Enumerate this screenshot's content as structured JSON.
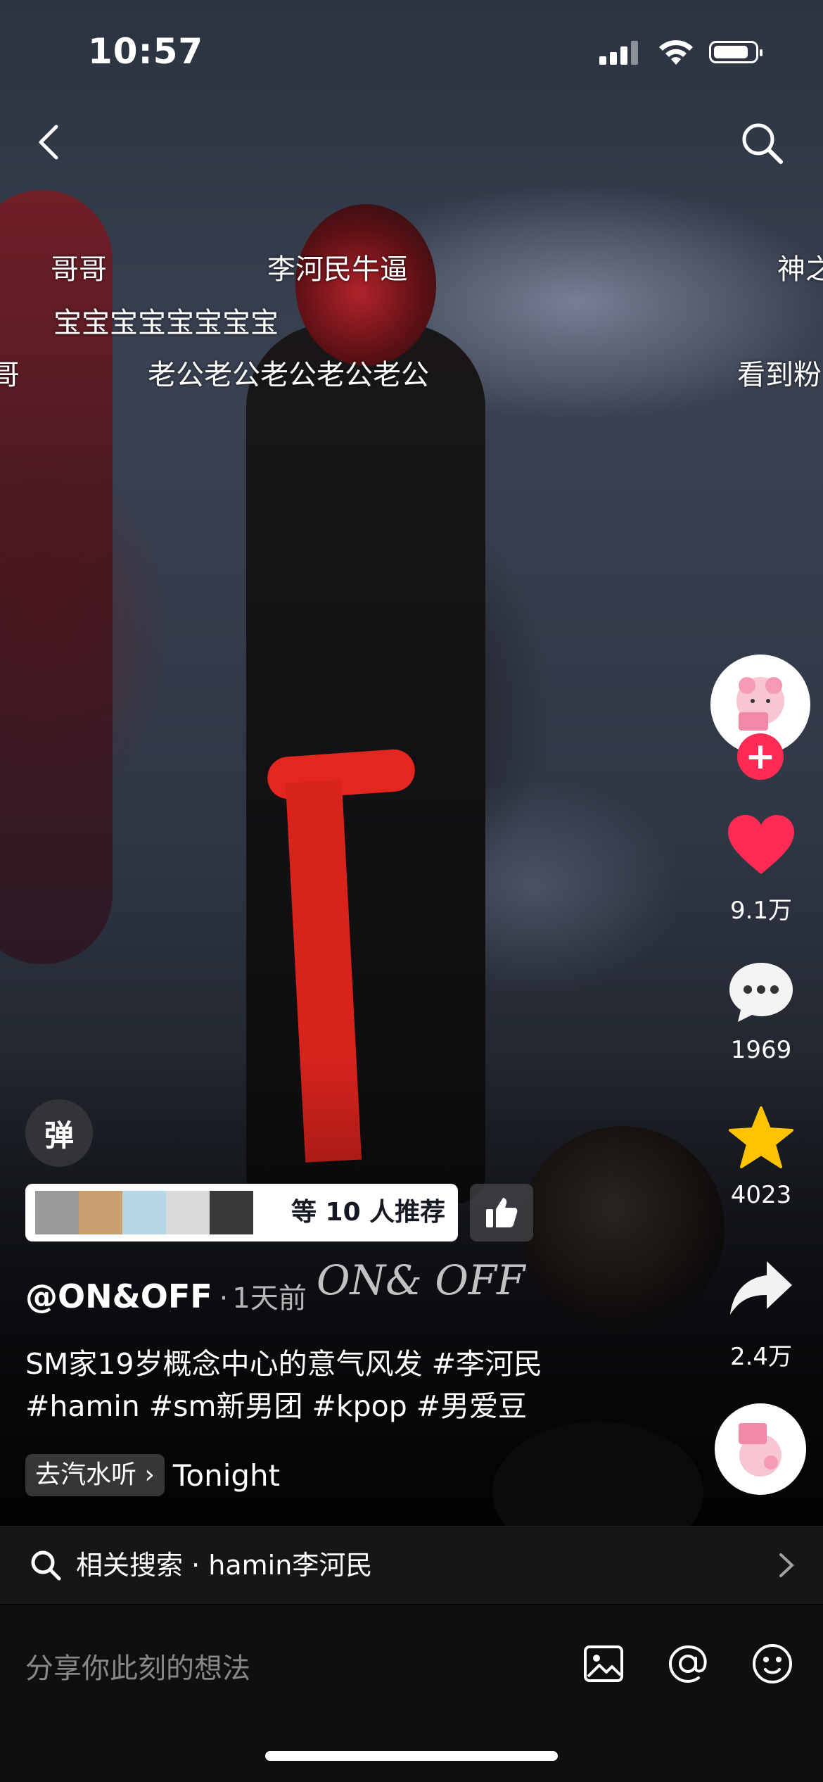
{
  "status_bar": {
    "time": "10:57"
  },
  "danmaku": [
    {
      "text": "哥哥"
    },
    {
      "text": "李河民牛逼"
    },
    {
      "text": "神之"
    },
    {
      "text": "宝宝宝宝宝宝宝宝"
    },
    {
      "text": "哥"
    },
    {
      "text": "老公老公老公老公老公"
    },
    {
      "text": "看到粉"
    }
  ],
  "rail": {
    "likes": "9.1万",
    "comments": "1969",
    "favorites": "4023",
    "shares": "2.4万",
    "like_color": "#fe2c55",
    "star_color": "#ffc300"
  },
  "danmu_toggle": {
    "label": "弹"
  },
  "recommend": {
    "text": "等 10 人推荐"
  },
  "post": {
    "author": "@ON&OFF",
    "separator": "·",
    "time_ago": "1天前",
    "watermark": "ON& OFF",
    "description": "SM家19岁概念中心的意气风发 #李河民 #hamin #sm新男团 #kpop #男爱豆"
  },
  "music": {
    "tag": "去汽水听",
    "song": "Tonight"
  },
  "related": {
    "label": "相关搜索",
    "dot": "·",
    "query": "hamin李河民"
  },
  "composer": {
    "placeholder": "分享你此刻的想法"
  },
  "icons": [
    "back-icon",
    "search-icon",
    "heart-icon",
    "comment-icon",
    "star-icon",
    "share-icon",
    "image-icon",
    "at-icon",
    "emoji-icon",
    "thumbs-up-icon",
    "chevron-right-icon",
    "plus-icon"
  ]
}
